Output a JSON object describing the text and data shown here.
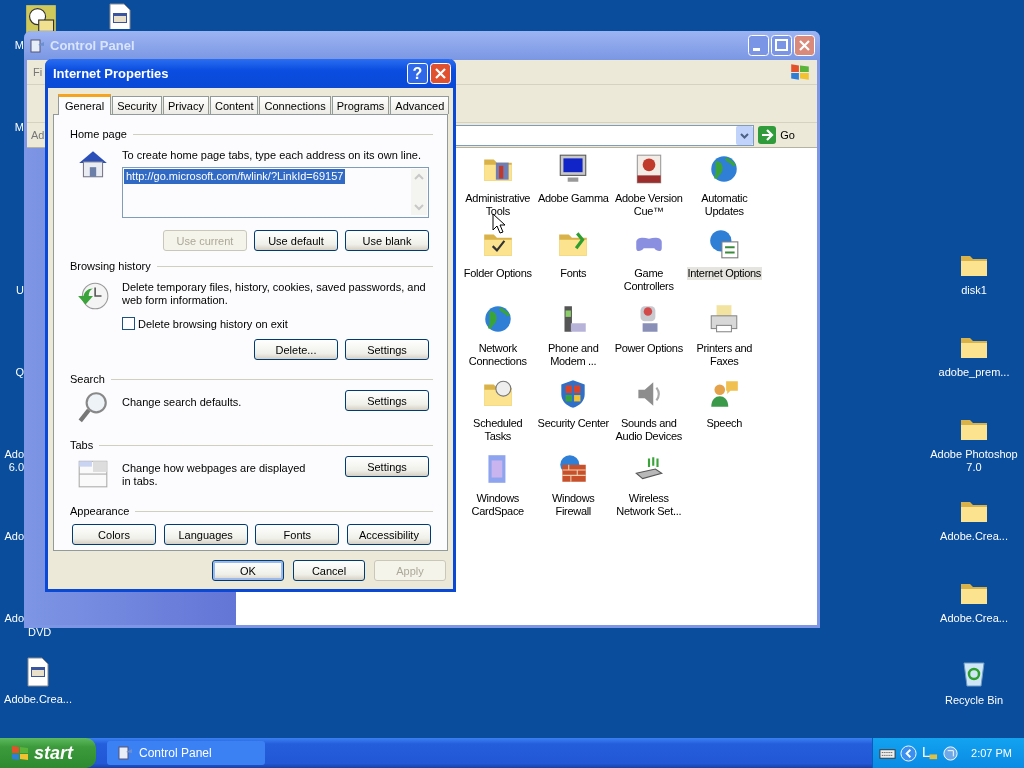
{
  "desktop": {
    "left_fragments": [
      "M",
      "M",
      "U",
      "Q",
      "Ado",
      "6.0",
      "Ado",
      "Ado",
      "DVD"
    ],
    "icons": [
      {
        "label": "Adobe.Crea...",
        "kind": "file"
      },
      {
        "label": "disk1",
        "kind": "folder"
      },
      {
        "label": "adobe_prem...",
        "kind": "folder"
      },
      {
        "label": "Adobe Photoshop 7.0",
        "kind": "folder"
      },
      {
        "label": "Adobe.Crea...",
        "kind": "folder"
      },
      {
        "label": "Adobe.Crea...",
        "kind": "folder"
      },
      {
        "label": "Recycle Bin",
        "kind": "recycle"
      }
    ]
  },
  "control_panel": {
    "title": "Control Panel",
    "menu_fragment": "Fi",
    "address_fragment": "Ad",
    "go": "Go",
    "items": [
      {
        "label": "Administrative Tools",
        "selected": false
      },
      {
        "label": "Adobe Gamma",
        "selected": false
      },
      {
        "label": "Adobe Version Cue™",
        "selected": false
      },
      {
        "label": "Automatic Updates",
        "selected": false
      },
      {
        "label": "Folder Options",
        "selected": false
      },
      {
        "label": "Fonts",
        "selected": false
      },
      {
        "label": "Game Controllers",
        "selected": false
      },
      {
        "label": "Internet Options",
        "selected": true
      },
      {
        "label": "Network Connections",
        "selected": false
      },
      {
        "label": "Phone and Modem ...",
        "selected": false
      },
      {
        "label": "Power Options",
        "selected": false
      },
      {
        "label": "Printers and Faxes",
        "selected": false
      },
      {
        "label": "Scheduled Tasks",
        "selected": false
      },
      {
        "label": "Security Center",
        "selected": false
      },
      {
        "label": "Sounds and Audio Devices",
        "selected": false
      },
      {
        "label": "Speech",
        "selected": false
      },
      {
        "label": "Windows CardSpace",
        "selected": false
      },
      {
        "label": "Windows Firewall",
        "selected": false
      },
      {
        "label": "Wireless Network Set...",
        "selected": false
      }
    ]
  },
  "dialog": {
    "title": "Internet Properties",
    "help_glyph": "?",
    "tabs": [
      {
        "label": "General",
        "selected": true
      },
      {
        "label": "Security",
        "selected": false
      },
      {
        "label": "Privacy",
        "selected": false
      },
      {
        "label": "Content",
        "selected": false
      },
      {
        "label": "Connections",
        "selected": false
      },
      {
        "label": "Programs",
        "selected": false
      },
      {
        "label": "Advanced",
        "selected": false
      }
    ],
    "home_page": {
      "heading": "Home page",
      "text": "To create home page tabs, type each address on its own line.",
      "url": "http://go.microsoft.com/fwlink/?LinkId=69157",
      "url_selected": true,
      "buttons": [
        {
          "label": "Use current",
          "disabled": true
        },
        {
          "label": "Use default",
          "disabled": false
        },
        {
          "label": "Use blank",
          "disabled": false
        }
      ]
    },
    "browsing_history": {
      "heading": "Browsing history",
      "text": "Delete temporary files, history, cookies, saved passwords, and web form information.",
      "checkbox": {
        "label": "Delete browsing history on exit",
        "checked": false
      },
      "buttons": [
        {
          "label": "Delete...",
          "disabled": false
        },
        {
          "label": "Settings",
          "disabled": false
        }
      ]
    },
    "search": {
      "heading": "Search",
      "text": "Change search defaults.",
      "buttons": [
        {
          "label": "Settings",
          "disabled": false
        }
      ]
    },
    "tabs_section": {
      "heading": "Tabs",
      "text": "Change how webpages are displayed in tabs.",
      "buttons": [
        {
          "label": "Settings",
          "disabled": false
        }
      ]
    },
    "appearance": {
      "heading": "Appearance",
      "buttons": [
        {
          "label": "Colors",
          "disabled": false
        },
        {
          "label": "Languages",
          "disabled": false
        },
        {
          "label": "Fonts",
          "disabled": false
        },
        {
          "label": "Accessibility",
          "disabled": false
        }
      ]
    },
    "footer": [
      {
        "label": "OK",
        "disabled": false,
        "default": true
      },
      {
        "label": "Cancel",
        "disabled": false,
        "default": false
      },
      {
        "label": "Apply",
        "disabled": true,
        "default": false
      }
    ]
  },
  "taskbar": {
    "start": "start",
    "tasks": [
      {
        "label": "Control Panel",
        "selected": false
      }
    ],
    "clock": "2:07 PM"
  }
}
